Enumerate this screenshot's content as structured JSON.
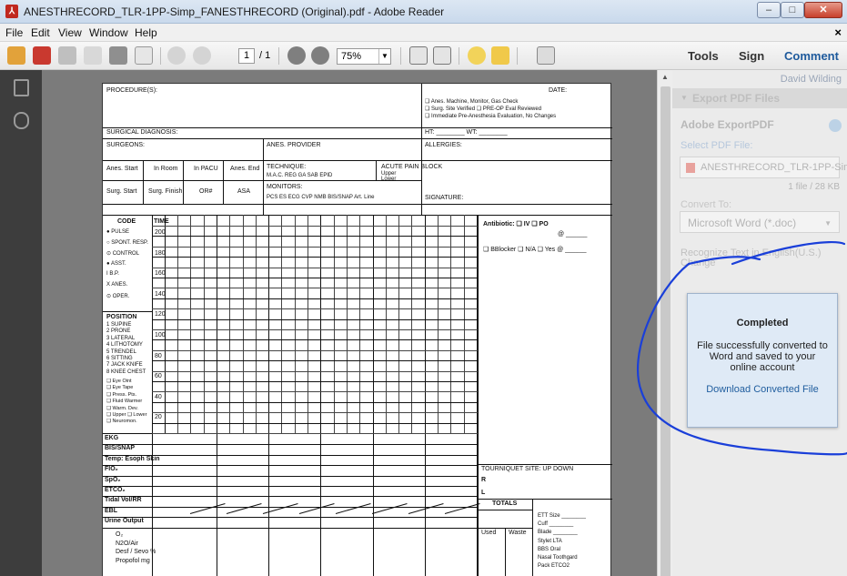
{
  "window": {
    "title": "ANESTHRECORD_TLR-1PP-Simp_FANESTHRECORD (Original).pdf - Adobe Reader",
    "app_icon": "adobe-reader-icon"
  },
  "menu": [
    "File",
    "Edit",
    "View",
    "Window",
    "Help"
  ],
  "toolbar": {
    "page_current": "1",
    "page_total": "/ 1",
    "zoom": "75%",
    "tools_label": "Tools",
    "sign_label": "Sign",
    "comment_label": "Comment"
  },
  "right_pane": {
    "user": "David Wilding",
    "section_title": "Export PDF Files",
    "service_title": "Adobe ExportPDF",
    "select_label": "Select PDF File:",
    "file_name": "ANESTHRECORD_TLR-1PP-Simp_....",
    "file_info": "1 file / 28 KB",
    "convert_label": "Convert To:",
    "convert_value": "Microsoft Word (*.doc)",
    "recognize_text": "Recognize Text in English(U.S.)",
    "change_link": "Change"
  },
  "dialog": {
    "title": "Completed",
    "message": "File successfully converted to Word and saved to your online account",
    "link": "Download Converted File"
  },
  "form": {
    "procedure": "PROCEDURE(S):",
    "date": "DATE:",
    "check1": "❑ Anes. Machine, Monitor, Gas Check",
    "check2": "❑ Surg. Site Verified  ❑ PRE-OP Eval Reviewed",
    "check3": "❑ Immediate Pre-Anesthesia Evaluation, No Changes",
    "surgical_dx": "SURGICAL DIAGNOSIS:",
    "ht": "HT: ________ WT: ________",
    "surgeons": "SURGEONS:",
    "anes_provider": "ANES. PROVIDER",
    "allergies": "ALLERGIES:",
    "anes_start": "Anes. Start",
    "in_room": "In Room",
    "in_pacu": "In PACU",
    "anes_end": "Anes. End",
    "technique": "TECHNIQUE:",
    "technique_opts": "M.A.C.   REG   GA   SAB   EPID",
    "acute_pain": "ACUTE PAIN BLOCK",
    "upper": "Upper",
    "lower": "Lower",
    "surg_start": "Surg. Start",
    "surg_finish": "Surg. Finish",
    "or_num": "OR#",
    "asa": "ASA",
    "monitors": "MONITORS:",
    "monitors_opts": "PCS   ES   ECG   CVP   NMB   BIS/SNAP   Art. Line",
    "signature": "SIGNATURE:",
    "code": "CODE",
    "time": "TIME",
    "codes": [
      "● PULSE",
      "○ SPONT. RESP.",
      "⊙ CONTROL",
      "● ASST.",
      "I  B.P.",
      "X  ANES.",
      "⊙ OPER."
    ],
    "scale": [
      "200",
      "180",
      "160",
      "140",
      "120",
      "100",
      "80",
      "60",
      "40",
      "20"
    ],
    "position": "POSITION",
    "positions": [
      "1 SUPINE",
      "2 PRONE",
      "3 LATERAL",
      "4 LITHOTOMY",
      "5 TRENDEL",
      "6 SITTING",
      "7 JACK KNIFE",
      "8 KNEE CHEST"
    ],
    "extras": [
      "❑ Eye Oint",
      "❑ Eye Tape",
      "❑ Press. Pts.",
      "❑ Fluid Warmer",
      "❑ Warm. Dev.",
      "❑ Upper ❑ Lower",
      "❑ Neuromon."
    ],
    "rows": [
      "EKG",
      "BIS/SNAP",
      "Temp: Esoph Skin",
      "FIO₂",
      "SpO₂",
      "ETCO₂",
      "Tidal Vol/RR",
      "EBL",
      "Urine Output"
    ],
    "agents": [
      "O₂",
      "N2O/Air",
      "Desf / Sevo %",
      "Propofol mg"
    ],
    "antibiotic": "Antibiotic: ❑ IV   ❑ PO",
    "at": "@ ______",
    "bblocker": "❑ BBlocker ❑ N/A ❑ Yes @ ______",
    "tourniquet": "TOURNIQUET SITE:   UP     DOWN",
    "r": "R",
    "l": "L",
    "totals": "TOTALS",
    "used": "Used",
    "waste": "Waste",
    "airway": [
      "ETT Size ________",
      "Cuff ________",
      "Blade ________",
      "Stylet      LTA",
      "BBS         Oral",
      "Nasal      Toothgard",
      "Pack       ETCO2"
    ]
  }
}
